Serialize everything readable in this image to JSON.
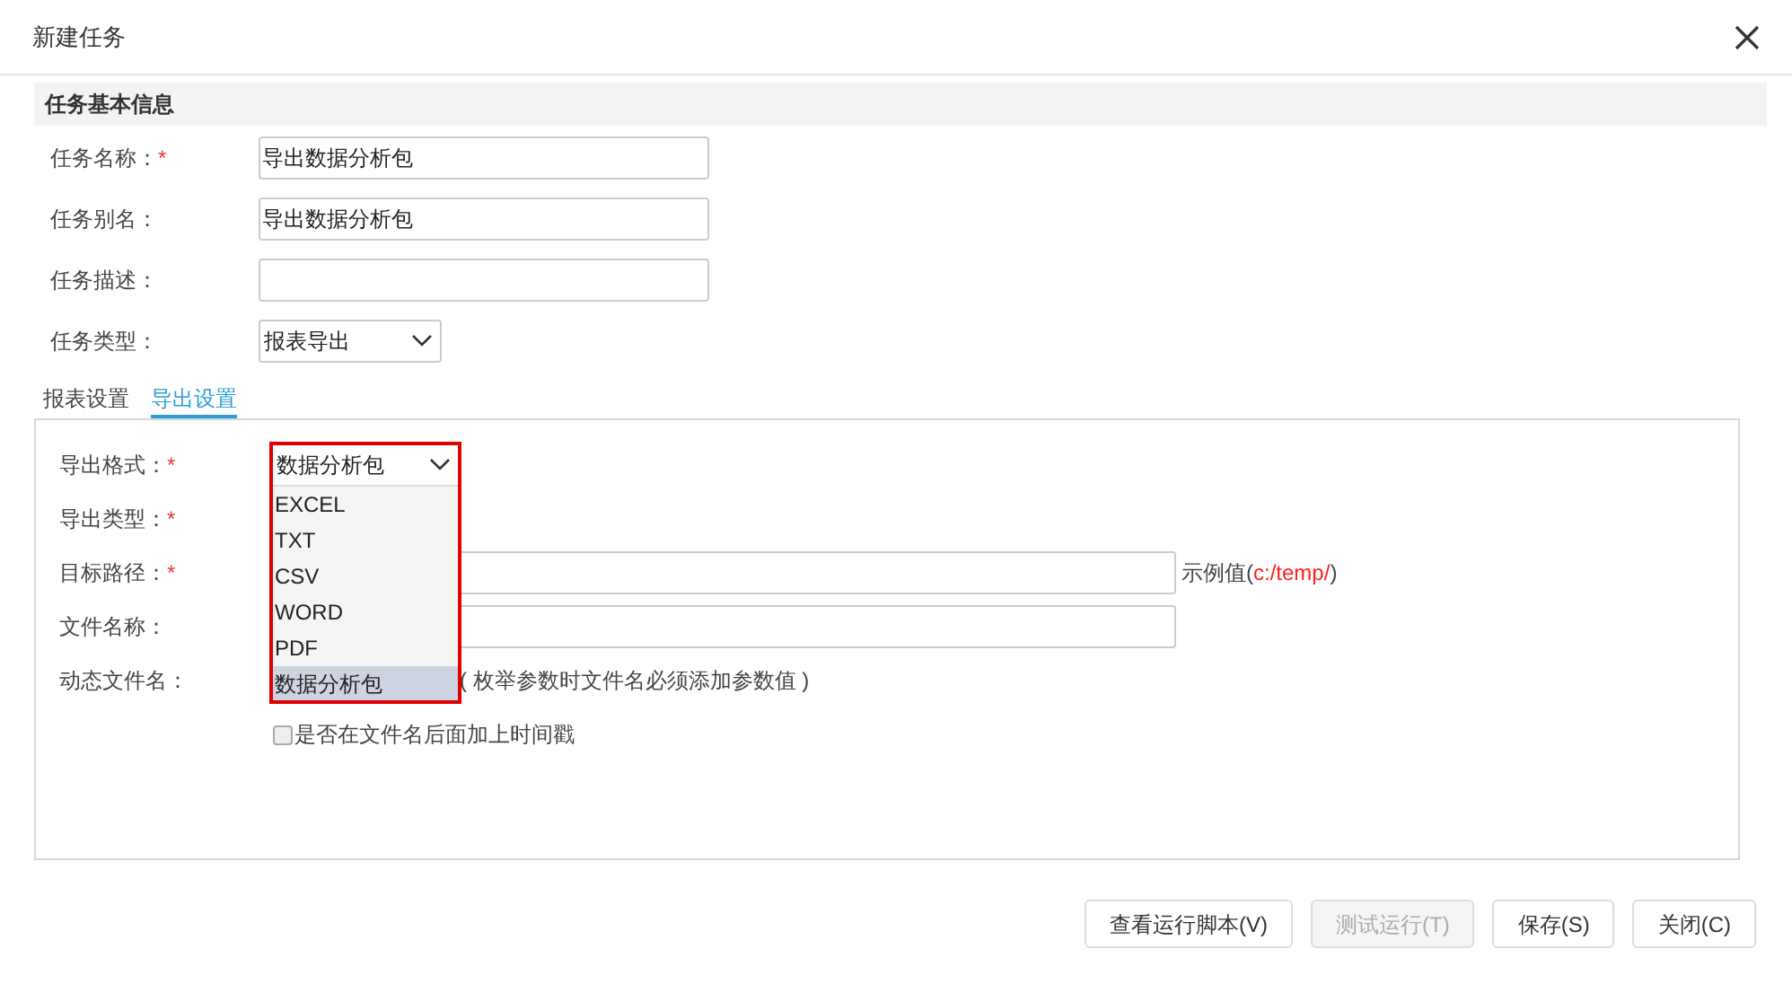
{
  "dialog": {
    "title": "新建任务"
  },
  "section": {
    "title": "任务基本信息"
  },
  "fields": [
    {
      "label": "任务名称：",
      "required_mark": "*",
      "kind": "text",
      "value": "导出数据分析包"
    },
    {
      "label": "任务别名：",
      "kind": "text",
      "value": "导出数据分析包"
    },
    {
      "label": "任务描述：",
      "kind": "text"
    },
    {
      "label": "任务类型：",
      "kind": "select",
      "value": "报表导出"
    }
  ],
  "tabs": [
    {
      "label": "报表设置",
      "selected": false
    },
    {
      "label": "导出设置",
      "selected": true
    }
  ],
  "export_rows": [
    {
      "label": "导出格式：",
      "required_mark": "*",
      "kind": "format"
    },
    {
      "label": "导出类型：",
      "required_mark": "*",
      "kind": "blank"
    },
    {
      "label": "目标路径：",
      "required_mark": "*",
      "kind": "path",
      "hint_prefix": "示例值(",
      "hint_example": "c:/temp/",
      "hint_suffix": ")"
    },
    {
      "label": "文件名称：",
      "kind": "input"
    },
    {
      "label": "动态文件名：",
      "kind": "note",
      "note": "( 枚举参数时文件名必须添加参数值 )"
    },
    {
      "kind": "checkbox",
      "checkbox_label": "是否在文件名后面加上时间戳",
      "checked": false
    }
  ],
  "format_select": {
    "value": "数据分析包",
    "options": [
      {
        "label": "EXCEL",
        "selected": false
      },
      {
        "label": "TXT",
        "selected": false
      },
      {
        "label": "CSV",
        "selected": false
      },
      {
        "label": "WORD",
        "selected": false
      },
      {
        "label": "PDF",
        "selected": false
      },
      {
        "label": "数据分析包",
        "selected": true
      }
    ]
  },
  "buttons": [
    {
      "label": "查看运行脚本(V)",
      "disabled": false
    },
    {
      "label": "测试运行(T)",
      "disabled": true
    },
    {
      "label": "保存(S)",
      "disabled": false
    },
    {
      "label": "关闭(C)",
      "disabled": false
    }
  ]
}
